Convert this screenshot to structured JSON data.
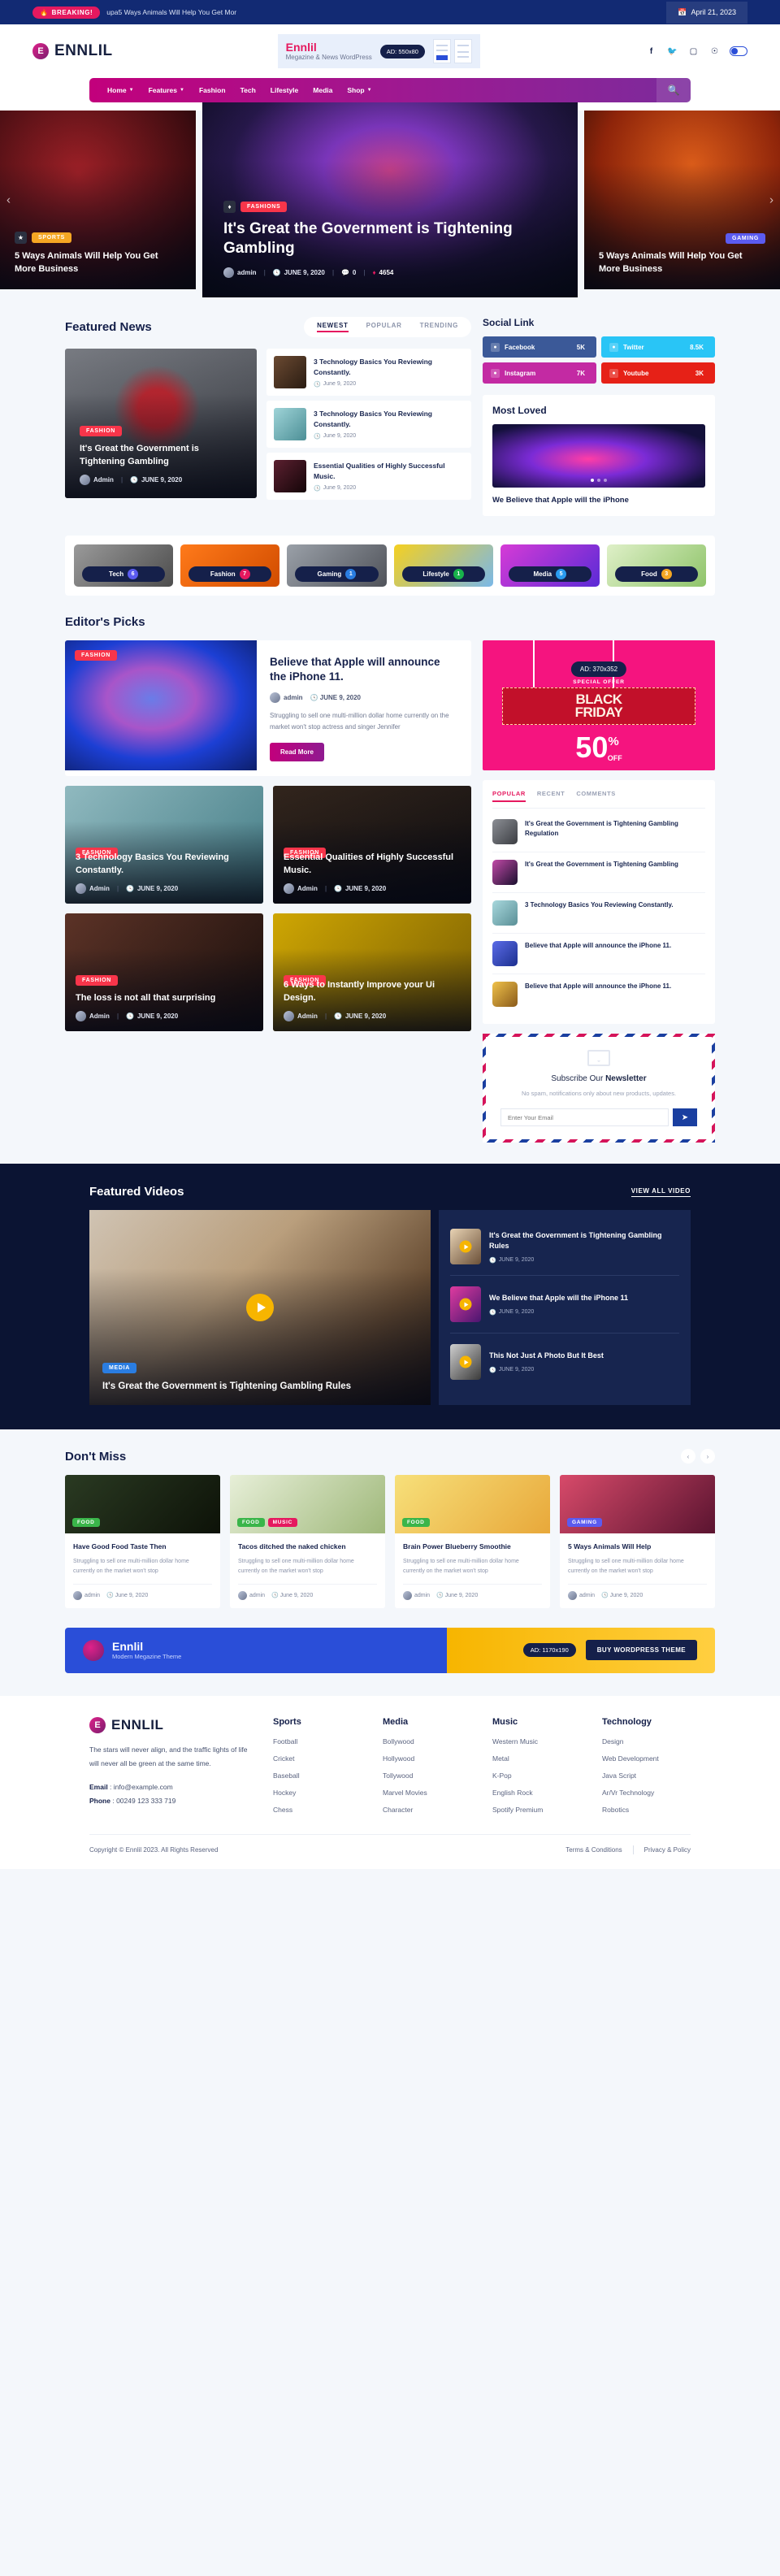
{
  "topbar": {
    "breaking_label": "BREAKING!",
    "breaking_text": "upa5 Ways Animals Will Help You Get Mor",
    "date": "April 21, 2023",
    "calendar_icon": "calendar-icon",
    "fire_icon": "fire-icon"
  },
  "header": {
    "brand": "ENNLIL",
    "ad": {
      "title": "Ennlil",
      "subtitle": "Megazine & News WordPress",
      "chip": "AD: 550x80"
    },
    "socials": [
      "facebook-icon",
      "twitter-icon",
      "instagram-icon",
      "pinterest-icon"
    ],
    "toggle": "dark-mode-toggle"
  },
  "nav": {
    "items": [
      {
        "label": "Home",
        "caret": true
      },
      {
        "label": "Features",
        "caret": true
      },
      {
        "label": "Fashion",
        "caret": false
      },
      {
        "label": "Tech",
        "caret": false
      },
      {
        "label": "Lifestyle",
        "caret": false
      },
      {
        "label": "Media",
        "caret": false
      },
      {
        "label": "Shop",
        "caret": true
      }
    ],
    "search_icon": "search-icon"
  },
  "hero": {
    "left": {
      "cat": "SPORTS",
      "title": "5 Ways Animals Will Help You Get More Business",
      "icon": "star-icon"
    },
    "main": {
      "cat": "FASHIONS",
      "title": "It's Great the Government is Tightening Gambling",
      "author": "admin",
      "date": "JUNE 9, 2020",
      "comments": "0",
      "views": "4654",
      "icon": "fire-icon"
    },
    "right": {
      "cat": "GAMING",
      "title": "5 Ways Animals Will Help You Get More Business"
    },
    "prev_icon": "chevron-left-icon",
    "next_icon": "chevron-right-icon"
  },
  "featured_news": {
    "title": "Featured News",
    "tabs": [
      "NEWEST",
      "POPULAR",
      "TRENDING"
    ],
    "active_tab": "NEWEST",
    "big": {
      "cat": "FASHION",
      "title": "It's Great the Government is Tightening Gambling",
      "author": "Admin",
      "date": "JUNE 9, 2020"
    },
    "items": [
      {
        "title": "3 Technology Basics You Reviewing Constantly.",
        "date": "June 9, 2020"
      },
      {
        "title": "3 Technology Basics You Reviewing Constantly.",
        "date": "June 9, 2020"
      },
      {
        "title": "Essential Qualities of Highly Successful Music.",
        "date": "June 9, 2020"
      }
    ]
  },
  "social_link": {
    "title": "Social Link",
    "items": [
      {
        "name": "Facebook",
        "count": "5K",
        "color": "#3b5998",
        "icon": "facebook-icon"
      },
      {
        "name": "Twitter",
        "count": "8.5K",
        "color": "#29c5f6",
        "icon": "twitter-icon"
      },
      {
        "name": "Instagram",
        "count": "7K",
        "color": "#c32aa3",
        "icon": "instagram-icon"
      },
      {
        "name": "Youtube",
        "count": "3K",
        "color": "#e62117",
        "icon": "youtube-icon"
      }
    ]
  },
  "most_loved": {
    "title": "Most Loved",
    "headline": "We Believe that Apple will the iPhone"
  },
  "categories": [
    {
      "name": "Tech",
      "count": "6",
      "color": "#5b5bf0"
    },
    {
      "name": "Fashion",
      "count": "7",
      "color": "#e5195f"
    },
    {
      "name": "Gaming",
      "count": "1",
      "color": "#2a7de1"
    },
    {
      "name": "Lifestyle",
      "count": "1",
      "color": "#18b24b"
    },
    {
      "name": "Media",
      "count": "5",
      "color": "#2a9bf0"
    },
    {
      "name": "Food",
      "count": "3",
      "color": "#f5a623"
    }
  ],
  "editors_picks": {
    "title": "Editor's Picks",
    "feature": {
      "cat": "FASHION",
      "title": "Believe that Apple will announce the iPhone 11.",
      "author": "admin",
      "date": "JUNE 9, 2020",
      "excerpt": "Struggling to sell one multi-million dollar home currently on the market won't stop actress and singer Jennifer",
      "button": "Read More"
    },
    "cards": [
      {
        "cat": "FASHION",
        "title": "3 Technology Basics You Reviewing Constantly.",
        "author": "Admin",
        "date": "JUNE 9, 2020"
      },
      {
        "cat": "FASHION",
        "title": "Essential Qualities of Highly Successful Music.",
        "author": "Admin",
        "date": "JUNE 9, 2020"
      },
      {
        "cat": "FASHION",
        "title": "The loss is not all that surprising",
        "author": "Admin",
        "date": "JUNE 9, 2020"
      },
      {
        "cat": "FASHION",
        "title": "6 Ways to Instantly Improve your Ui Design.",
        "author": "Admin",
        "date": "JUNE 9, 2020"
      }
    ]
  },
  "sidebar_ad": {
    "chip": "AD: 370x352",
    "special": "SPECIAL OFFER",
    "line1": "BLACK",
    "line2": "FRIDAY",
    "percent": "50",
    "pct_sign": "%",
    "off": "OFF"
  },
  "popular": {
    "tabs": [
      "POPULAR",
      "RECENT",
      "COMMENTS"
    ],
    "active_tab": "POPULAR",
    "items": [
      {
        "title": "It's Great the Government is Tightening Gambling Regulation"
      },
      {
        "title": "It's Great the Government is Tightening Gambling"
      },
      {
        "title": "3 Technology Basics You Reviewing Constantly."
      },
      {
        "title": "Believe that Apple will announce the iPhone 11."
      },
      {
        "title": "Believe that Apple will announce the iPhone 11."
      }
    ]
  },
  "newsletter": {
    "title_pre": "Subscribe Our ",
    "title_bold": "Newsletter",
    "desc": "No spam, notifications only about new products, updates.",
    "placeholder": "Enter Your Email",
    "value": "",
    "submit_icon": "send-icon"
  },
  "featured_videos": {
    "title": "Featured Videos",
    "view_all": "VIEW ALL VIDEO",
    "main": {
      "cat": "MEDIA",
      "title": "It's Great the Government is Tightening Gambling Rules",
      "play_icon": "play-icon"
    },
    "items": [
      {
        "title": "It's Great the Government is Tightening Gambling Rules",
        "date": "JUNE 9, 2020"
      },
      {
        "title": "We Believe that Apple will the iPhone 11",
        "date": "JUNE 9, 2020"
      },
      {
        "title": "This Not Just A Photo But It Best",
        "date": "JUNE 9, 2020"
      }
    ]
  },
  "dont_miss": {
    "title": "Don't Miss",
    "prev_icon": "chevron-left-icon",
    "next_icon": "chevron-right-icon",
    "cards": [
      {
        "cats": [
          {
            "label": "FOOD",
            "cls": "food"
          }
        ],
        "title": "Have Good Food Taste Then",
        "excerpt": "Struggling to sell one multi-million dollar home currently on the market won't stop",
        "author": "admin",
        "date": "June 9, 2020"
      },
      {
        "cats": [
          {
            "label": "FOOD",
            "cls": "food"
          },
          {
            "label": "MUSIC",
            "cls": "music"
          }
        ],
        "title": "Tacos ditched the naked chicken",
        "excerpt": "Struggling to sell one multi-million dollar home currently on the market won't stop",
        "author": "admin",
        "date": "June 9, 2020"
      },
      {
        "cats": [
          {
            "label": "FOOD",
            "cls": "food"
          }
        ],
        "title": "Brain Power Blueberry Smoothie",
        "excerpt": "Struggling to sell one multi-million dollar home currently on the market won't stop",
        "author": "admin",
        "date": "June 9, 2020"
      },
      {
        "cats": [
          {
            "label": "GAMING",
            "cls": "gaming"
          }
        ],
        "title": "5 Ways Animals Will Help",
        "excerpt": "Struggling to sell one multi-million dollar home currently on the market won't stop",
        "author": "admin",
        "date": "June 9, 2020"
      }
    ]
  },
  "promo": {
    "name": "Ennlil",
    "sub": "Modern Megazine Theme",
    "chip": "AD: 1170x190",
    "button": "BUY WORDPRESS THEME"
  },
  "footer": {
    "brand": "ENNLIL",
    "about": "The stars will never align, and the traffic lights of life will never all be green at the same time.",
    "email_label": "Email",
    "email": "info@example.com",
    "phone_label": "Phone",
    "phone": "00249 123 333 719",
    "columns": [
      {
        "title": "Sports",
        "links": [
          "Football",
          "Cricket",
          "Baseball",
          "Hockey",
          "Chess"
        ]
      },
      {
        "title": "Media",
        "links": [
          "Bollywood",
          "Hollywood",
          "Tollywood",
          "Marvel Movies",
          "Character"
        ]
      },
      {
        "title": "Music",
        "links": [
          "Western Music",
          "Metal",
          "K-Pop",
          "English Rock",
          "Spotify Premium"
        ]
      },
      {
        "title": "Technology",
        "links": [
          "Design",
          "Web Development",
          "Java Script",
          "Ar/Vr Technology",
          "Robotics"
        ]
      }
    ],
    "copyright": "Copyright © Ennlil 2023. All Rights Reserved",
    "terms": "Terms & Conditions",
    "privacy": "Privacy & Policy"
  }
}
